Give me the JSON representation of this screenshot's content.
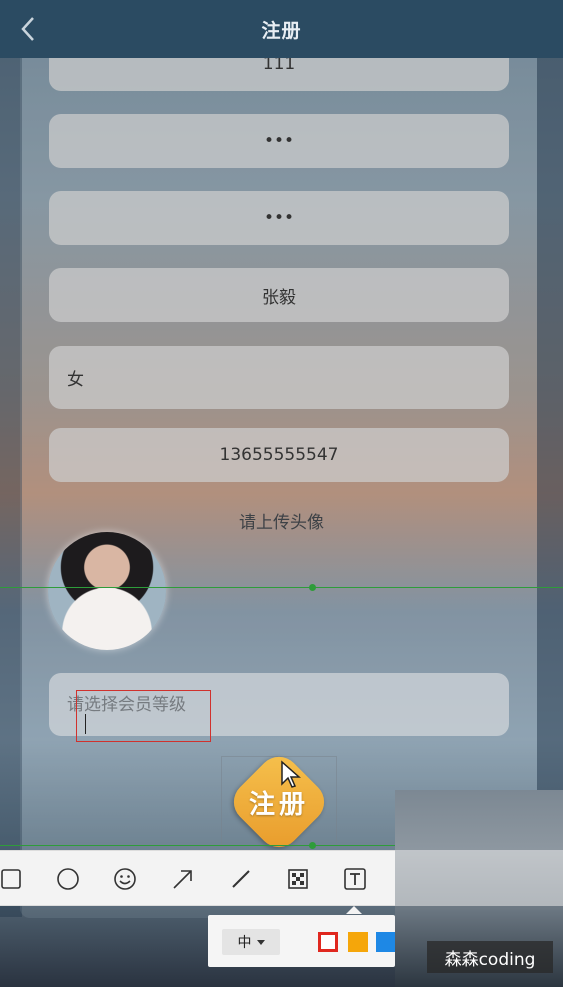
{
  "header": {
    "title": "注册",
    "back_icon": "chevron-left-icon"
  },
  "form": {
    "username_value": "111",
    "password_value": "•••",
    "confirm_password_value": "•••",
    "name_value": "张毅",
    "gender_value": "女",
    "phone_value": "13655555547",
    "avatar_hint": "请上传头像",
    "member_level_placeholder": "请选择会员等级",
    "register_label": "注册"
  },
  "annotation_toolbar": {
    "tools": [
      "rectangle-icon",
      "ellipse-icon",
      "emoji-icon",
      "arrow-icon",
      "pen-icon",
      "mosaic-icon",
      "text-icon"
    ],
    "active_tool": "text-icon",
    "font_size_label": "中",
    "colors": [
      "#e0281f",
      "#f5a60a",
      "#1e88e5"
    ]
  },
  "watermark": "森森coding",
  "colors": {
    "header_bg": "#2b4b62",
    "guide_line": "#2e9c3a",
    "selection_border": "#d0312d",
    "register_button": "#f0b040"
  }
}
